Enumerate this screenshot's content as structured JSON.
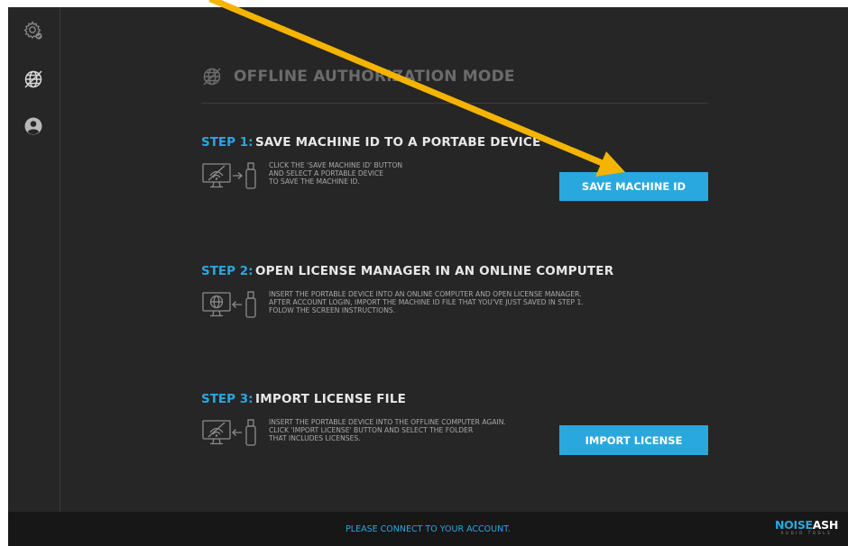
{
  "icons": {
    "sidebar": [
      "settings-gear-icon",
      "offline-globe-icon",
      "user-account-icon"
    ],
    "title": "offline-globe-icon",
    "step_devices": [
      "save-to-usb-icon",
      "online-computer-usb-icon",
      "import-from-usb-icon"
    ]
  },
  "colors": {
    "background": "#262626",
    "footer": "#171717",
    "accent": "#29a8e0",
    "heading_dim": "#6b6b6b",
    "annotation_arrow": "#f5b400"
  },
  "header": {
    "title": "OFFLINE AUTHORIZATION MODE"
  },
  "steps": [
    {
      "num": "STEP 1:",
      "title": "SAVE MACHINE ID TO A PORTABE DEVICE",
      "lines": [
        "CLICK THE 'SAVE MACHINE ID' BUTTON",
        "AND SELECT A PORTABLE DEVICE",
        "TO SAVE THE MACHINE ID."
      ],
      "button": "SAVE MACHINE ID"
    },
    {
      "num": "STEP 2:",
      "title": "OPEN LICENSE MANAGER IN AN ONLINE COMPUTER",
      "lines": [
        "INSERT THE PORTABLE DEVICE INTO AN ONLINE COMPUTER AND OPEN LICENSE MANAGER.",
        "AFTER ACCOUNT LOGIN, IMPORT THE MACHINE ID FILE THAT YOU'VE JUST SAVED IN STEP 1.",
        "FOLOW THE SCREEN INSTRUCTIONS."
      ]
    },
    {
      "num": "STEP 3:",
      "title": "IMPORT LICENSE FILE",
      "lines": [
        "INSERT THE PORTABLE DEVICE INTO THE OFFLINE COMPUTER AGAIN.",
        "CLICK 'IMPORT LICENSE' BUTTON AND SELECT THE FOLDER",
        "THAT INCLUDES LICENSES."
      ],
      "button": "IMPORT LICENSE"
    }
  ],
  "footer": {
    "message": "PLEASE CONNECT TO YOUR ACCOUNT.",
    "brand_part1": "NOISE",
    "brand_part2": "ASH",
    "brand_tagline": "AUDIO TOOLS"
  }
}
